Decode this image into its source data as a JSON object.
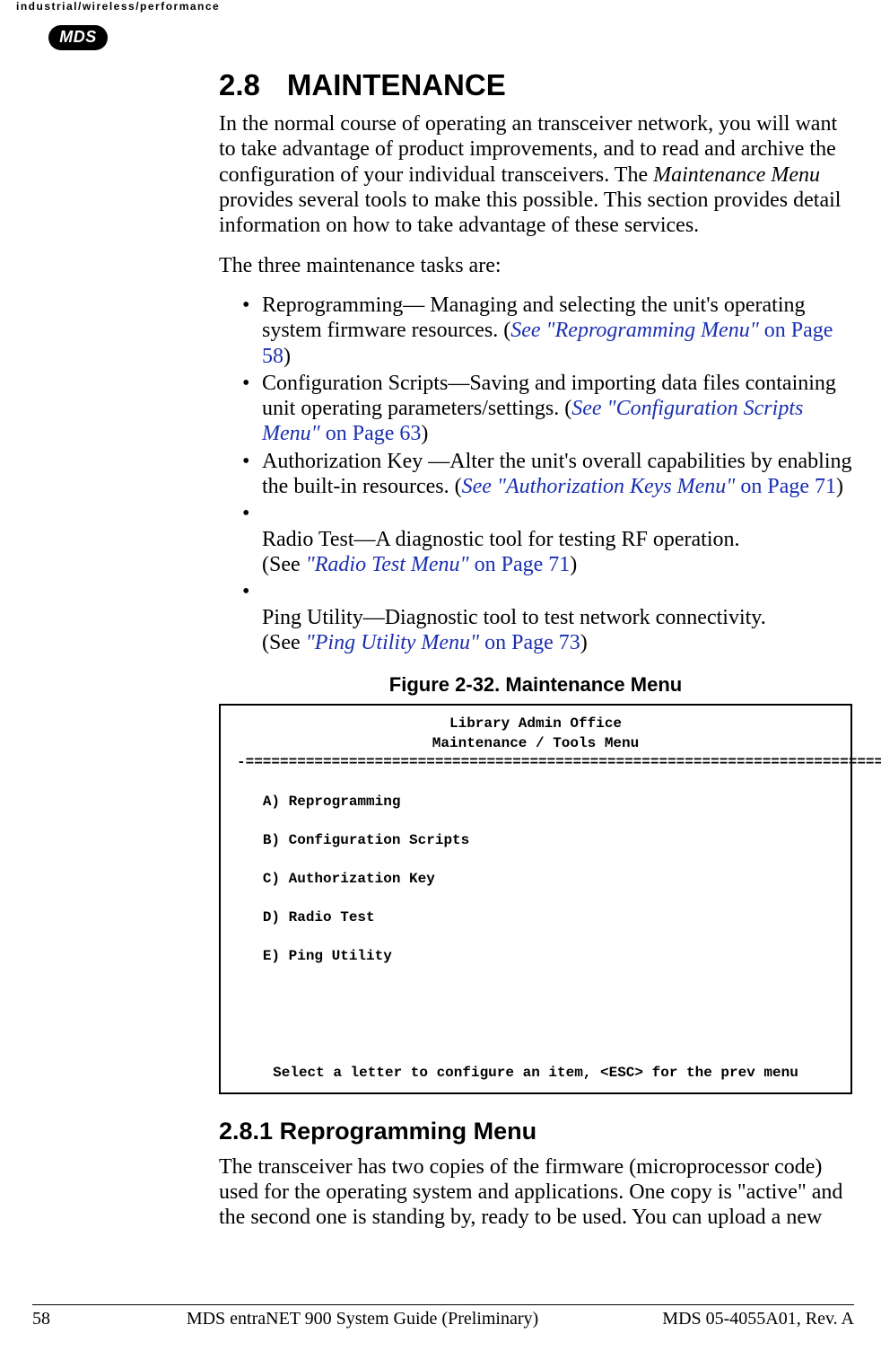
{
  "header": {
    "tagline": "industrial/wireless/performance",
    "logo_text": "MDS"
  },
  "section": {
    "number": "2.8",
    "title": "MAINTENANCE"
  },
  "intro_part1": "In the normal course of operating an transceiver network, you will want to take advantage of product improvements, and to read and archive the configuration of your individual transceivers. The ",
  "intro_menu_name": "Maintenance Menu",
  "intro_part2": " provides several tools to make this possible. This section provides detail information on how to take advantage of these services.",
  "intro_tasks_lead": "The three maintenance tasks are:",
  "tasks": [
    {
      "lead": "Reprogramming— Managing and selecting the unit's operating system firmware resources. ",
      "open": "(",
      "ref_ital": "See \"Reprogramming Menu\"",
      "ref_plain": " on Page 58",
      "close": ")"
    },
    {
      "lead": "Configuration Scripts—Saving and importing data files containing unit operating parameters/settings. ",
      "open": "(",
      "ref_ital": "See \"Configuration Scripts Menu\"",
      "ref_plain": " on Page 63",
      "close": ")"
    },
    {
      "lead": "Authorization Key —Alter the unit's overall capabilities by enabling the built-in resources. (",
      "open": "",
      "ref_ital": "See \"Authorization Keys Menu\"",
      "ref_plain": " on Page 71",
      "close": ")"
    },
    {
      "lead": "Radio Test—A diagnostic tool for testing RF operation.\n(See ",
      "open": "",
      "ref_ital": "\"Radio Test Menu\"",
      "ref_plain": " on Page 71",
      "close": ")"
    },
    {
      "lead": "Ping Utility—Diagnostic tool to test network connectivity.\n(See ",
      "open": "",
      "ref_ital": "\"Ping Utility Menu\"",
      "ref_plain": " on Page 73",
      "close": ")"
    }
  ],
  "figure": {
    "caption": "Figure 2-32. Maintenance Menu",
    "line_title1": "Library Admin Office",
    "line_title2": "Maintenance / Tools Menu",
    "rule": "-==========================================================================-",
    "item_a": "A) Reprogramming",
    "item_b": "B) Configuration Scripts",
    "item_c": "C) Authorization Key",
    "item_d": "D) Radio Test",
    "item_e": "E) Ping Utility",
    "prompt": "Select a letter to configure an item, <ESC> for the prev menu"
  },
  "subsection": {
    "number": "2.8.1",
    "title": "Reprogramming Menu",
    "body": "The transceiver has two copies of the firmware (microprocessor code) used for the operating system and applications. One copy is \"active\" and the second one is standing by, ready to be used. You can upload a new"
  },
  "footer": {
    "page": "58",
    "title": "MDS entraNET 900 System Guide (Preliminary)",
    "rev": "MDS 05-4055A01, Rev. A"
  }
}
